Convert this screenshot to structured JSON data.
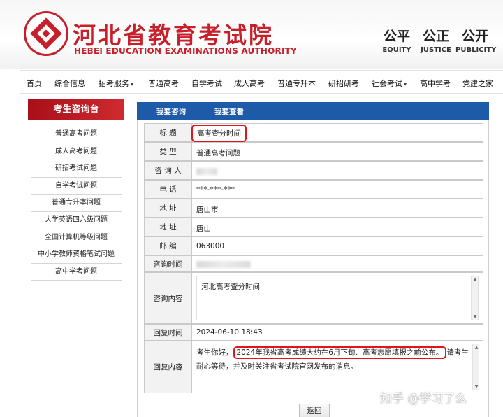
{
  "header": {
    "title": "河北省教育考试院",
    "subtitle": "HEBEI EDUCATION EXAMINATIONS AUTHORITY",
    "mottos": [
      {
        "cn": "公平",
        "en": "EQUITY"
      },
      {
        "cn": "公正",
        "en": "JUSTICE"
      },
      {
        "cn": "公开",
        "en": "PUBLICITY"
      }
    ]
  },
  "nav": {
    "items": [
      "首页",
      "综合信息",
      "招考服务",
      "普通高考",
      "自学考试",
      "成人高考",
      "普通专升本",
      "研招研考",
      "社会考试",
      "高中学考",
      "党建之家"
    ]
  },
  "sidebar": {
    "heading": "考生咨询台",
    "items": [
      "普通高考问题",
      "成人高考问题",
      "研招考试问题",
      "自学考试问题",
      "普通专升本问题",
      "大学英语四六级问题",
      "全国计算机等级问题",
      "中小学教师资格笔试问题",
      "高中学考问题"
    ]
  },
  "tabs": [
    "我要咨询",
    "我要查看"
  ],
  "detail": {
    "title_label": "标 题",
    "title_value": "高考查分时间",
    "type_label": "类 型",
    "type_value": "普通高考问题",
    "asker_label": "咨 询 人",
    "phone_label": "电 话",
    "phone_value": "***-***-***",
    "address_label": "地 址",
    "address_value_1": "唐山市",
    "address_value_2": "唐山",
    "postcode_label": "邮 编",
    "postcode_value": "063000",
    "consult_time_label": "咨询时间",
    "content_label": "咨询内容",
    "content_value": "河北高考查分时间",
    "reply_time_label": "回复时间",
    "reply_time_value": "2024-06-10 18:43",
    "reply_label": "回复内容",
    "reply_prefix": "考生你好，",
    "reply_highlight": "2024年我省高考成绩大约在6月下旬、高考志愿填报之前公布。",
    "reply_suffix": "请考生耐心等待，并及时关注省考试院官网发布的消息。"
  },
  "back_label": "返回",
  "watermark": "知乎 @学习了么",
  "colors": {
    "brand_red": "#c8202a",
    "tab_blue": "#1d5aa7",
    "highlight_red": "#e2141c"
  }
}
